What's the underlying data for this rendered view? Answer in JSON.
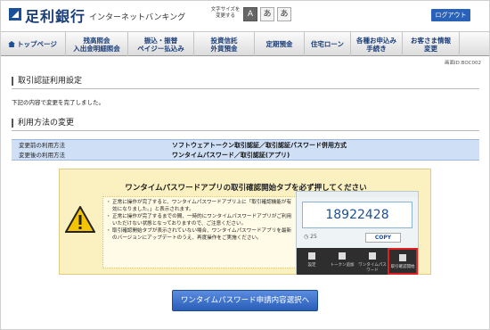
{
  "header": {
    "bank_name": "足利銀行",
    "service_name": "インターネットバンキング",
    "font_size_label": "文字サイズを変更する",
    "font_sizes": [
      "A",
      "あ",
      "あ"
    ],
    "logout": "ログアウト"
  },
  "nav": {
    "items": [
      {
        "label": "トップページ"
      },
      {
        "label": "残高照会\n入出金明細照会"
      },
      {
        "label": "振込・振替\nペイジー払込み"
      },
      {
        "label": "投資信託\n外貨預金"
      },
      {
        "label": "定期預金"
      },
      {
        "label": "住宅ローン"
      },
      {
        "label": "各種お申込み\n手続き"
      },
      {
        "label": "お客さま情報\n変更"
      }
    ]
  },
  "screen_id": "画面ID:BOC002",
  "section1": {
    "title": "取引認証利用設定",
    "message": "下記の内容で変更を完了しました。"
  },
  "section2": {
    "title": "利用方法の変更",
    "rows": [
      {
        "label": "変更前の利用方法",
        "value": "ソフトウェアトークン取引認証／取引認証パスワード併用方式"
      },
      {
        "label": "変更後の利用方法",
        "value": "ワンタイムパスワード／取引認証(アプリ)"
      }
    ]
  },
  "notice": {
    "title": "ワンタイムパスワードアプリの取引確認開始タブを必ず押してください",
    "bullets": [
      "正常に操作が完了すると、ワンタイムパスワードアプリ上に「取引確認機能が有効になりました。」と表示されます。",
      "正常に操作が完了するまでの間、一時的にワンタイムパスワードアプリがご利用いただけない状態となっておりますので、ご注意ください。",
      "取引確認開始タブが表示されていない場合、ワンタイムパスワードアプリを最新のバージョンにアップデートのうえ、再度操作をご実施ください。"
    ],
    "phone": {
      "otp": "18922428",
      "timer": "25",
      "copy": "COPY",
      "tabs": [
        "設定",
        "トークン追加",
        "ワンタイムパスワード",
        "取引確認開始"
      ]
    }
  },
  "cta": "ワンタイムパスワード申請内容選択へ",
  "colors": {
    "brand": "#1a3e7a",
    "accent": "#2a62b8",
    "notice_bg": "#fbf0c0",
    "table_bg": "#cfe0f6"
  }
}
